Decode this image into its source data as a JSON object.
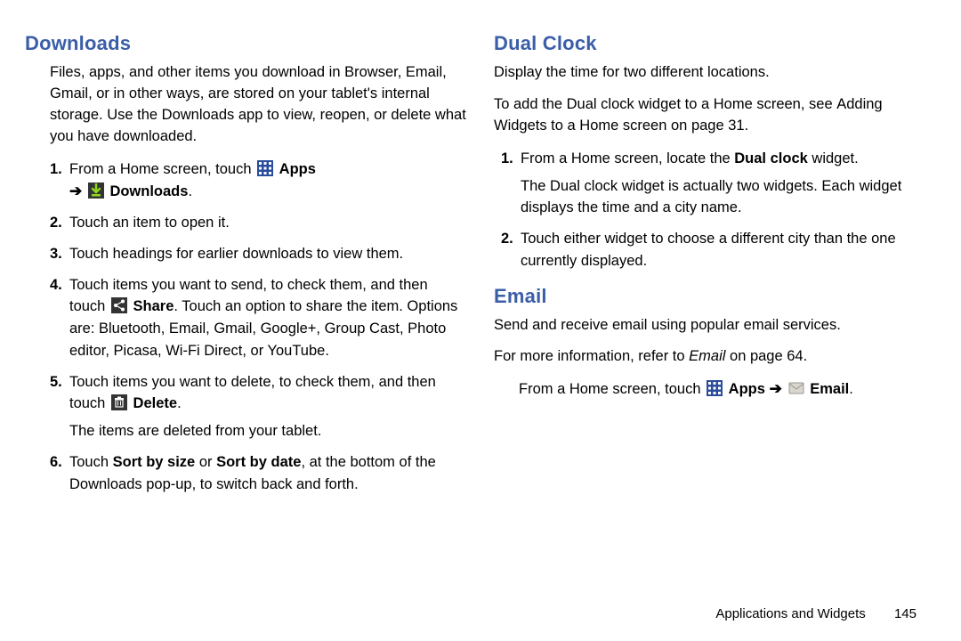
{
  "left": {
    "h_downloads": "Downloads",
    "intro_dl": "Files, apps, and other items you download in Browser, Email, Gmail, or in other ways, are stored on your tablet's internal storage. Use the Downloads app to view, reopen, or delete what you have downloaded.",
    "steps": [
      {
        "n": "1.",
        "t1": "From a Home screen, touch ",
        "apps": "Apps",
        "t2": "Downloads",
        "t3": "."
      },
      {
        "n": "2.",
        "txt": "Touch an item to open it."
      },
      {
        "n": "3.",
        "txt": "Touch headings for earlier downloads to view them."
      },
      {
        "n": "4.",
        "t1": "Touch items you want to send, to check them, and then touch ",
        "share": "Share",
        "t2": ". Touch an option to share the item. Options are: Bluetooth, Email, Gmail, Google+, Group Cast, Photo editor, Picasa, Wi-Fi Direct, or YouTube."
      },
      {
        "n": "5.",
        "t1": "Touch items you want to delete, to check them, and then touch ",
        "del": "Delete",
        "t2": ".",
        "sub": "The items are deleted from your tablet."
      },
      {
        "n": "6.",
        "t1": "Touch ",
        "b1": "Sort by size",
        "or": " or ",
        "b2": "Sort by date",
        "t2": ", at the bottom of the Downloads pop-up, to switch back and forth."
      }
    ]
  },
  "right": {
    "h_dual": "Dual Clock",
    "dual_intro": "Display the time for two different locations.",
    "dual_add_1": "To add the Dual clock widget to a Home screen, see ",
    "dual_add_link": "Adding Widgets to a Home screen",
    "dual_add_2": " on page 31.",
    "dual_steps": [
      {
        "n": "1.",
        "t1": "From a Home screen, locate the ",
        "b": "Dual clock",
        "t2": " widget.",
        "sub": "The Dual clock widget is actually two widgets. Each widget displays the time and a city name."
      },
      {
        "n": "2.",
        "txt": "Touch either widget to choose a different city than the one currently displayed."
      }
    ],
    "h_email": "Email",
    "em_intro": "Send and receive email using popular email services.",
    "em_ref_1": "For more information, refer to ",
    "em_ref_link": "Email",
    "em_ref_2": " on page 64.",
    "em_path_1": "From a Home screen, touch ",
    "em_apps": "Apps",
    "em_arrow": " ➔ ",
    "em_email": "Email",
    "em_dot": "."
  },
  "footer": {
    "section": "Applications and Widgets",
    "page": "145"
  }
}
